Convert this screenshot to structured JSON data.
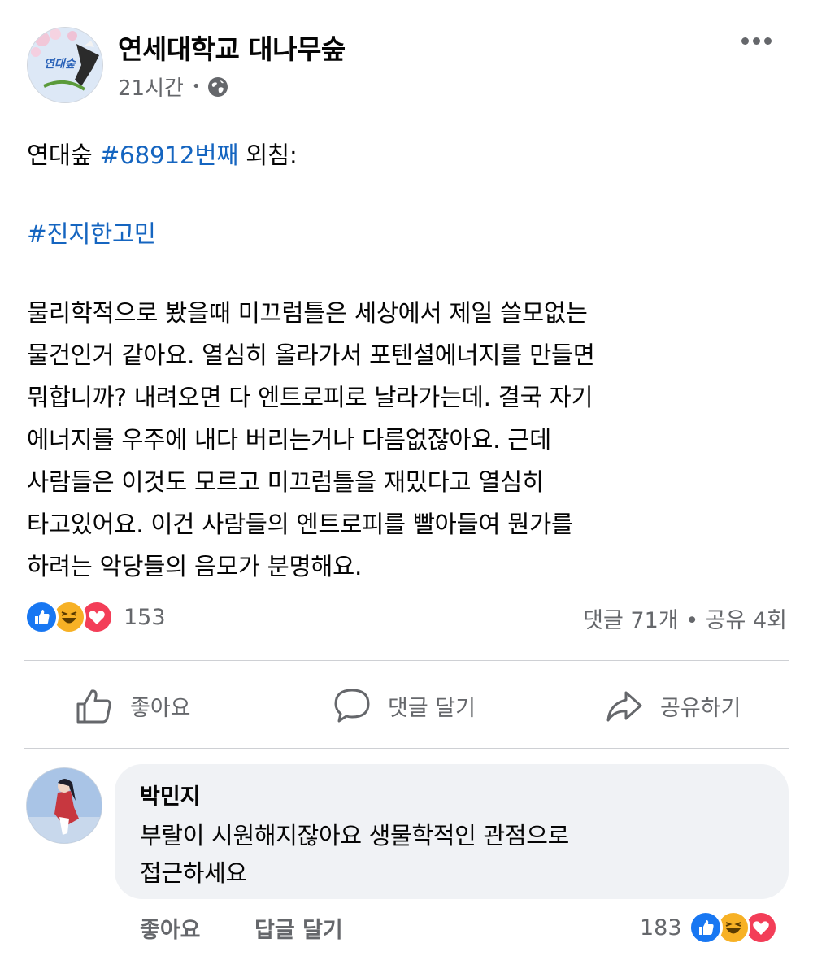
{
  "post": {
    "page_name": "연세대학교 대나무숲",
    "avatar_text": "연대숲",
    "time": "21시간",
    "meta_dot": "•",
    "privacy_icon": "globe-icon",
    "body": {
      "intro_prefix": "연대숲 ",
      "intro_hashtag": "#68912번째",
      "intro_suffix": " 외침:",
      "hashtag": "#진지한고민",
      "lines": [
        "물리학적으로 봤을때 미끄럼틀은 세상에서 제일 쓸모없는",
        "물건인거 같아요. 열심히 올라가서 포텐셜에너지를 만들면",
        "뭐합니까? 내려오면 다 엔트로피로 날라가는데. 결국 자기",
        "에너지를 우주에 내다 버리는거나 다름없잖아요. 근데",
        "사람들은 이것도 모르고 미끄럼틀을 재밌다고 열심히",
        "타고있어요. 이건 사람들의 엔트로피를 빨아들여 뭔가를",
        "하려는 악당들의 음모가 분명해요."
      ]
    },
    "reaction_count": "153",
    "stats": "댓글 71개 • 공유 4회",
    "actions": {
      "like": "좋아요",
      "comment": "댓글 달기",
      "share": "공유하기"
    }
  },
  "comment": {
    "author": "박민지",
    "lines": [
      "부랄이 시원해지잖아요 생물학적인 관점으로",
      "접근하세요"
    ],
    "like": "좋아요",
    "reply": "답글 달기",
    "reaction_count": "183"
  },
  "colors": {
    "hashtag": "#1565c0",
    "like_blue": "#1877f2",
    "love_red": "#f33e58",
    "haha_yellow": "#f7b125",
    "secondary_text": "#65676b",
    "bubble_bg": "#f0f2f5"
  }
}
